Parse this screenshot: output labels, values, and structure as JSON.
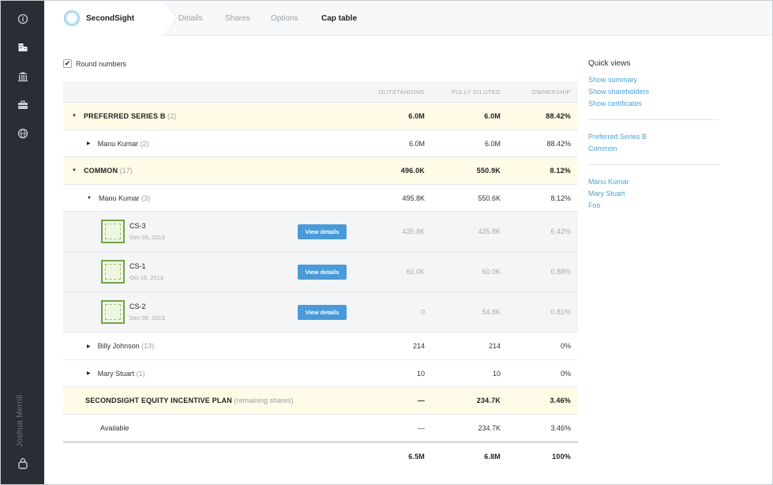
{
  "sidebar": {
    "user_name": "Joshua Merrill",
    "icons": [
      "info-icon",
      "building-icon",
      "bank-icon",
      "briefcase-icon",
      "globe-icon",
      "logout-icon"
    ]
  },
  "topbar": {
    "brand": "SecondSight",
    "tabs": [
      "Details",
      "Shares",
      "Options",
      "Cap table"
    ],
    "active_tab": "Cap table"
  },
  "controls": {
    "round_numbers_label": "Round numbers",
    "round_numbers_checked": true
  },
  "table": {
    "headers": [
      "OUTSTANDING",
      "FULLY DILUTED",
      "OWNERSHIP"
    ],
    "rows": [
      {
        "type": "group",
        "label": "PREFERRED SERIES B",
        "count": "(2)",
        "outstanding": "6.0M",
        "diluted": "6.0M",
        "ownership": "88.42%"
      },
      {
        "type": "holder",
        "label": "Manu Kumar",
        "count": "(2)",
        "outstanding": "6.0M",
        "diluted": "6.0M",
        "ownership": "88.42%"
      },
      {
        "type": "group",
        "label": "COMMON",
        "count": "(17)",
        "outstanding": "496.0K",
        "diluted": "550.9K",
        "ownership": "8.12%"
      },
      {
        "type": "holder-open",
        "label": "Manu Kumar",
        "count": "(3)",
        "outstanding": "495.8K",
        "diluted": "550.6K",
        "ownership": "8.12%"
      },
      {
        "type": "cert",
        "label": "CS-3",
        "date": "Dec 05, 2013",
        "button": "View details",
        "outstanding": "435.8K",
        "diluted": "435.8K",
        "ownership": "6.42%"
      },
      {
        "type": "cert",
        "label": "CS-1",
        "date": "Oct 16, 2013",
        "button": "View details",
        "outstanding": "60.0K",
        "diluted": "60.0K",
        "ownership": "0.88%"
      },
      {
        "type": "cert",
        "label": "CS-2",
        "date": "Dec 05, 2013",
        "button": "View details",
        "outstanding": "0",
        "diluted": "54.8K",
        "ownership": "0.81%"
      },
      {
        "type": "holder",
        "label": "Billy Johnson",
        "count": "(13)",
        "outstanding": "214",
        "diluted": "214",
        "ownership": "0%"
      },
      {
        "type": "holder",
        "label": "Mary Stuart",
        "count": "(1)",
        "outstanding": "10",
        "diluted": "10",
        "ownership": "0%"
      },
      {
        "type": "group",
        "label": "SECONDSIGHT EQUITY INCENTIVE PLAN",
        "count": "(remaining shares)",
        "outstanding": "—",
        "diluted": "234.7K",
        "ownership": "3.46%"
      },
      {
        "type": "plain",
        "label": "Available",
        "count": "",
        "outstanding": "—",
        "diluted": "234.7K",
        "ownership": "3.46%"
      },
      {
        "type": "total",
        "label": "",
        "count": "",
        "outstanding": "6.5M",
        "diluted": "6.8M",
        "ownership": "100%"
      }
    ]
  },
  "quick_views": {
    "title": "Quick views",
    "links_a": [
      "Show summary",
      "Show shareholders",
      "Show certificates"
    ],
    "links_b": [
      "Preferred Series B",
      "Common"
    ],
    "links_c": [
      "Manu Kumar",
      "Mary Stuart",
      "Foo"
    ]
  },
  "colors": {
    "accent": "#4a9ad9",
    "group_bg": "#fffbe6",
    "nav_bg": "#2a2e34"
  }
}
